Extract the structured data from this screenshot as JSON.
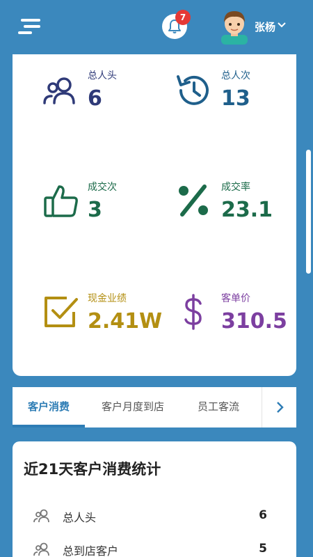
{
  "header": {
    "notification_count": "7",
    "username": "张杨"
  },
  "stats": [
    {
      "label": "总人头",
      "value": "6",
      "color": "#2f3a78",
      "icon": "users-icon"
    },
    {
      "label": "总人次",
      "value": "13",
      "color": "#1f5f8b",
      "icon": "history-icon"
    },
    {
      "label": "成交次",
      "value": "3",
      "color": "#1c6b4a",
      "icon": "thumbs-up-icon"
    },
    {
      "label": "成交率",
      "value": "23.1",
      "color": "#1c6b4a",
      "icon": "percent-icon"
    },
    {
      "label": "现金业绩",
      "value": "2.41W",
      "color": "#b38f12",
      "icon": "checkbox-icon"
    },
    {
      "label": "客单价",
      "value": "310.5",
      "color": "#7c3fa0",
      "icon": "dollar-icon"
    }
  ],
  "tabs": [
    {
      "label": "客户消费",
      "active": true
    },
    {
      "label": "客户月度到店",
      "active": false
    },
    {
      "label": "员工客流",
      "active": false
    }
  ],
  "summary": {
    "title": "近21天客户消费统计",
    "rows": [
      {
        "label": "总人头",
        "value": "6"
      },
      {
        "label": "总到店客户",
        "value": "5"
      }
    ]
  }
}
